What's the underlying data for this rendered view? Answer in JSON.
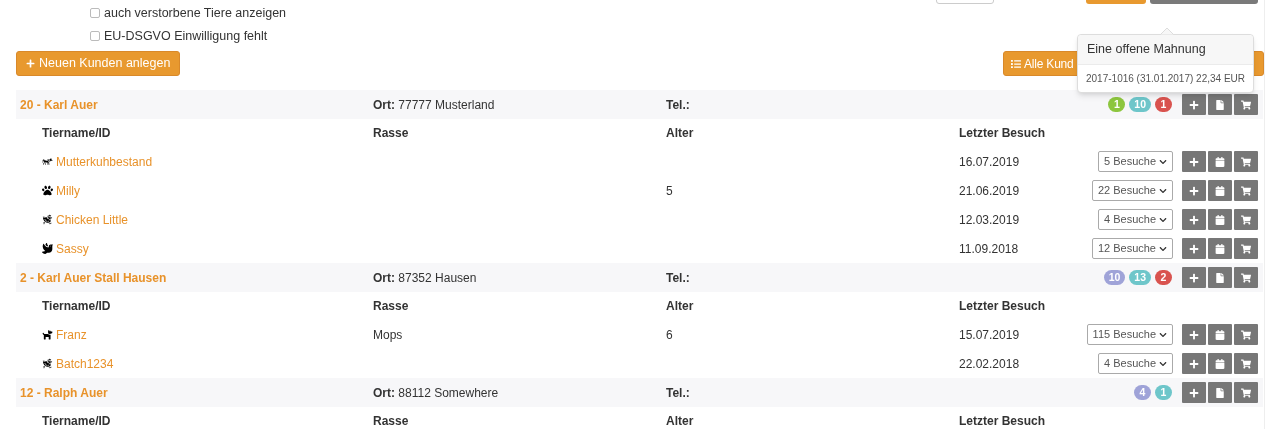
{
  "filters": [
    {
      "label": "auch verstorbene Tiere anzeigen",
      "checked": false
    },
    {
      "label": "EU-DSGVO Einwilligung fehlt",
      "checked": false
    }
  ],
  "new_customer_button": "Neuen Kunden anlegen",
  "all_customers_button": "Alle Kund",
  "tooltip": {
    "title": "Eine offene Mahnung",
    "body": "2017-1016 (31.01.2017) 22,34 EUR"
  },
  "customers": [
    {
      "name": "20 - Karl Auer",
      "ort": "**Ort:** 77777 Musterland",
      "tel": "Tel.:",
      "badges": [
        {
          "count": "1",
          "color": "#8dc63f"
        },
        {
          "count": "10",
          "color": "#6ec6ca"
        },
        {
          "count": "1",
          "color": "#d9534f"
        }
      ],
      "columns": [
        "Tiername/ID",
        "Rasse",
        "Alter",
        "Letzter Besuch"
      ],
      "animals": [
        {
          "kind": "cow",
          "name": "Mutterkuhbestand",
          "last_visit": "16.07.2019",
          "visits": "5 Besuche"
        },
        {
          "kind": "paw",
          "name": "Milly",
          "age": "5",
          "last_visit": "21.06.2019",
          "visits": "22 Besuche"
        },
        {
          "kind": "chicken",
          "name": "Chicken Little",
          "last_visit": "12.03.2019",
          "visits": "4 Besuche"
        },
        {
          "kind": "bird",
          "name": "Sassy",
          "last_visit": "11.09.2018",
          "visits": "12 Besuche"
        }
      ]
    },
    {
      "name": "2 - Karl Auer Stall Hausen",
      "ort": "**Ort:** 87352 Hausen",
      "tel": "Tel.:",
      "badges": [
        {
          "count": "10",
          "color": "#9fa3d8"
        },
        {
          "count": "13",
          "color": "#6ec6ca"
        },
        {
          "count": "2",
          "color": "#d9534f"
        }
      ],
      "columns": [
        "Tiername/ID",
        "Rasse",
        "Alter",
        "Letzter Besuch"
      ],
      "animals": [
        {
          "kind": "dog",
          "name": "Franz",
          "breed": "Mops",
          "age": "6",
          "last_visit": "15.07.2019",
          "visits": "115 Besuche"
        },
        {
          "kind": "chicken",
          "name": "Batch1234",
          "last_visit": "22.02.2018",
          "visits": "4 Besuche"
        }
      ]
    },
    {
      "name": "12 - Ralph Auer",
      "ort": "**Ort:** 88112 Somewhere",
      "tel": "Tel.:",
      "badges": [
        {
          "count": "4",
          "color": "#9fa3d8"
        },
        {
          "count": "1",
          "color": "#6ec6ca"
        }
      ],
      "columns": [
        "Tiername/ID",
        "Rasse",
        "Alter",
        "Letzter Besuch"
      ]
    }
  ]
}
